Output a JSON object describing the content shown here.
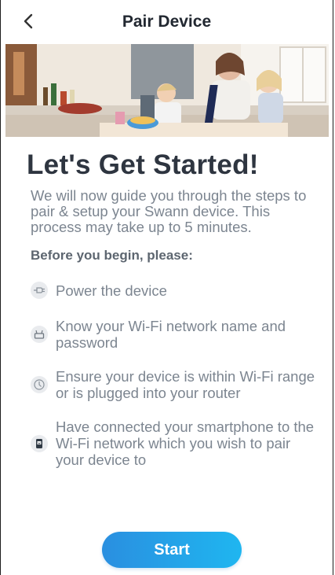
{
  "header": {
    "title": "Pair Device"
  },
  "main": {
    "heading": "Let's Get Started!",
    "intro": "We will now guide you through the steps to pair & setup your Swann device. This process may take up to 5 minutes.",
    "subhead": "Before you begin, please:",
    "steps": [
      {
        "icon": "plug-icon",
        "text": "Power the device"
      },
      {
        "icon": "router-icon",
        "text": "Know your Wi-Fi network name and password"
      },
      {
        "icon": "clock-icon",
        "text": "Ensure your device is within Wi-Fi range or is plugged into your router"
      },
      {
        "icon": "smartphone-icon",
        "text": "Have connected your smartphone to the Wi-Fi network which you wish to pair your device to"
      }
    ],
    "start_label": "Start"
  },
  "colors": {
    "accent_start": "#2a8fe0",
    "accent_end": "#1fb6f0",
    "heading": "#2e3540",
    "body_text": "#7c8590"
  }
}
